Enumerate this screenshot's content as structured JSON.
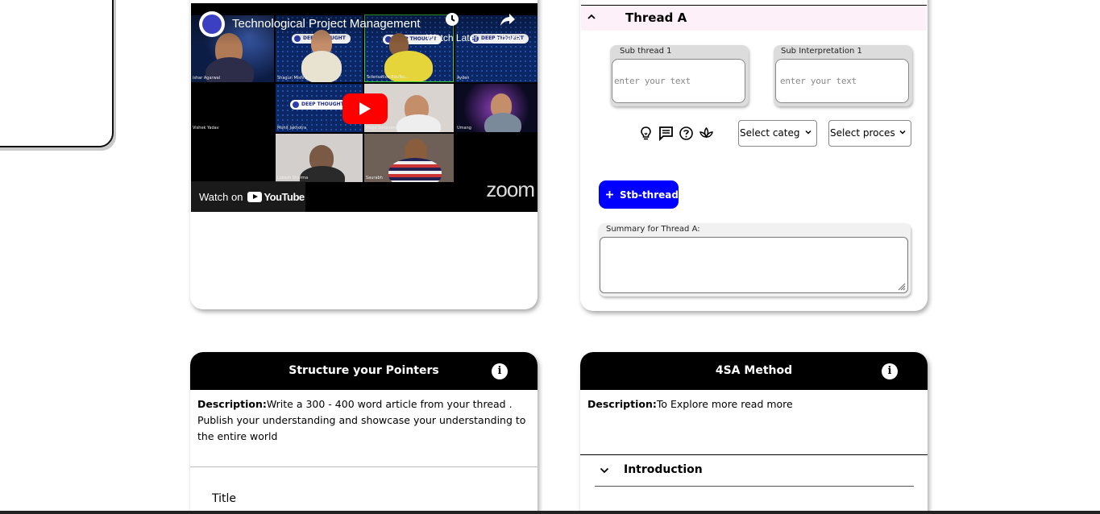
{
  "video": {
    "title": "Technological Project Management",
    "watch_later_label": "Watch Later",
    "share_label": "Share",
    "watch_on_label": "Watch on",
    "youtube_label": "YouTube",
    "zoom_label": "zoom",
    "brand_pill": "DEEP THOUGHT",
    "participants": [
      "ishar Agarwal",
      "Shagun Mishra",
      "Sciensation EduTec...",
      "Ayden",
      "Vishek Yadav",
      "Mohit Jakhotra",
      "Pooja Sonavane",
      "Umang",
      "Lokesh Sharma",
      "Saurabh"
    ]
  },
  "thread": {
    "title": "Thread A",
    "sub_thread_label": "Sub thread 1",
    "sub_interpretation_label": "Sub Interpretation 1",
    "sub_thread_placeholder": "enter your text",
    "sub_interpretation_placeholder": "enter your text",
    "select_category": "Select categ",
    "select_process": "Select proces",
    "add_button_label": "Stb-thread",
    "summary_label": "Summary for Thread A:",
    "icons": [
      "lightbulb-icon",
      "message-icon",
      "question-icon",
      "lotus-icon"
    ]
  },
  "pointers": {
    "title": "Structure your Pointers",
    "desc_label": "Description:",
    "desc_text": "Write a 300 - 400 word article from your thread . Publish your understanding and showcase your understanding to the entire world",
    "title_field_label": "Title"
  },
  "method": {
    "title": "4SA Method",
    "desc_label": "Description:",
    "desc_text": "To Explore more read more",
    "intro_label": "Introduction"
  },
  "colors": {
    "accent_blue": "#0000ff",
    "header_black": "#000000",
    "thread_header_bg": "#fdf0f9",
    "youtube_red": "#ff0000"
  }
}
